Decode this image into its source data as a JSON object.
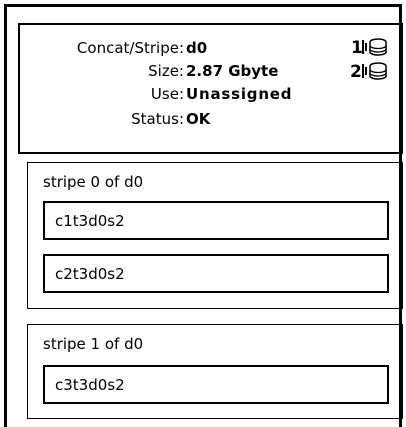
{
  "info": {
    "concat_label": "Concat/Stripe:",
    "concat_value": "d0",
    "size_label": "Size:",
    "size_value": "2.87 Gbyte",
    "use_label": "Use:",
    "use_value": "Unassigned",
    "status_label": "Status:",
    "status_value": "OK"
  },
  "markers": [
    {
      "number": "1",
      "icon": "disk-stack-icon"
    },
    {
      "number": "2",
      "icon": "disk-stack-icon"
    }
  ],
  "stripes": [
    {
      "title": "stripe 0 of d0",
      "slices": [
        "c1t3d0s2",
        "c2t3d0s2"
      ]
    },
    {
      "title": "stripe 1 of d0",
      "slices": [
        "c3t3d0s2"
      ]
    }
  ]
}
